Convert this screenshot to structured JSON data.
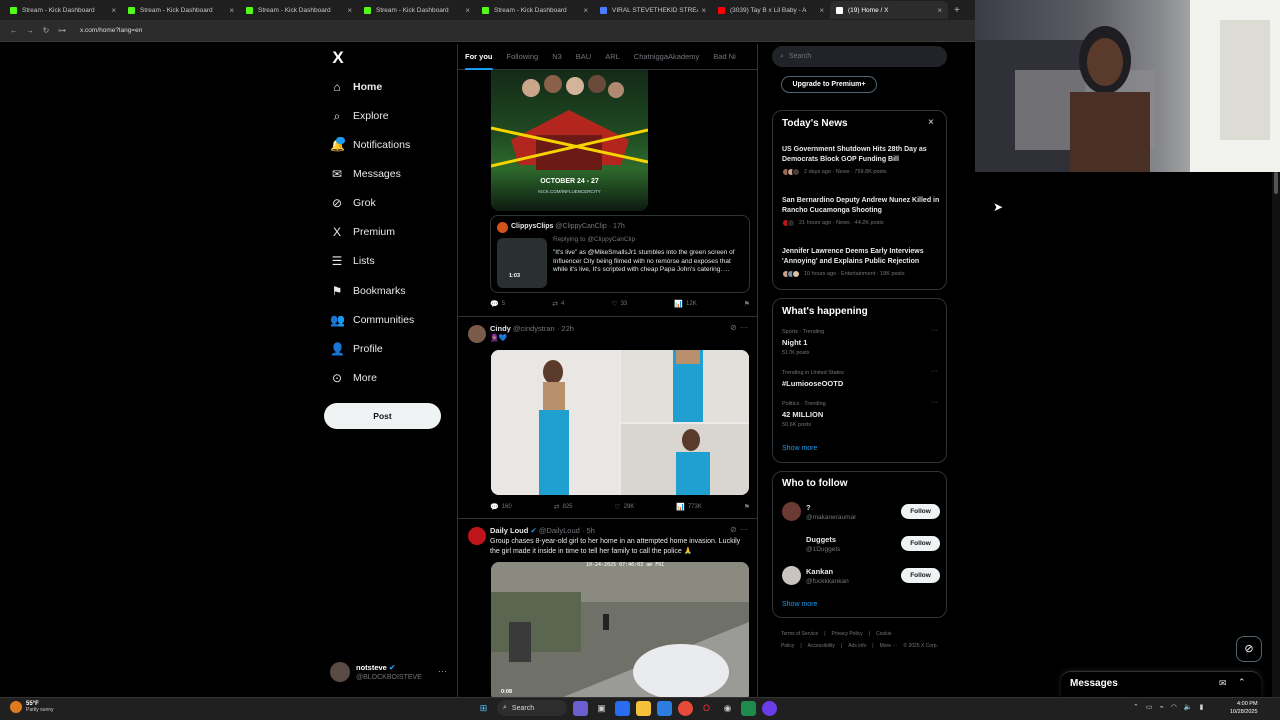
{
  "browser": {
    "tabs": [
      {
        "label": "Stream - Kick Dashboard",
        "color": "#53fc18"
      },
      {
        "label": "Stream - Kick Dashboard",
        "color": "#53fc18"
      },
      {
        "label": "Stream - Kick Dashboard",
        "color": "#53fc18"
      },
      {
        "label": "Stream - Kick Dashboard",
        "color": "#53fc18"
      },
      {
        "label": "Stream - Kick Dashboard",
        "color": "#53fc18"
      },
      {
        "label": "VIRAL STEVETHEKID STREAM",
        "color": "#4a7cff"
      },
      {
        "label": "(3039) Tay B x Lil Baby - A",
        "color": "#ff0000"
      },
      {
        "label": "(19) Home / X",
        "color": "#ffffff"
      }
    ],
    "url": "x.com/home?lang=en"
  },
  "nav": {
    "logo": "X",
    "items": [
      {
        "label": "Home",
        "icon": "home-icon",
        "glyph": "⌂"
      },
      {
        "label": "Explore",
        "icon": "search-icon",
        "glyph": "⌕"
      },
      {
        "label": "Notifications",
        "icon": "bell-icon",
        "glyph": "🔔"
      },
      {
        "label": "Messages",
        "icon": "mail-icon",
        "glyph": "✉"
      },
      {
        "label": "Grok",
        "icon": "grok-icon",
        "glyph": "⊘"
      },
      {
        "label": "Premium",
        "icon": "x-icon",
        "glyph": "X"
      },
      {
        "label": "Lists",
        "icon": "list-icon",
        "glyph": "☰"
      },
      {
        "label": "Bookmarks",
        "icon": "bookmark-icon",
        "glyph": "⚑"
      },
      {
        "label": "Communities",
        "icon": "people-icon",
        "glyph": "👥"
      },
      {
        "label": "Profile",
        "icon": "person-icon",
        "glyph": "👤"
      },
      {
        "label": "More",
        "icon": "more-circle-icon",
        "glyph": "⊙"
      }
    ],
    "notifications_badge": "",
    "post_button": "Post",
    "account": {
      "name": "notsteve",
      "handle": "@BLOCKBOISTEVE"
    }
  },
  "timeline": {
    "tabs": [
      "For you",
      "Following",
      "N3",
      "BAU",
      "ARL",
      "ChatniggaAkademy",
      "Bad Ni"
    ],
    "quote": {
      "name": "ClippysClips",
      "handle": "@ClippyCanClip",
      "time": "· 17h",
      "replying": "Replying to @ClippyCanClip",
      "duration": "1:03",
      "text": "\"It's live\" as @MikeSmallsJr1 stumbles into the green screen of Influencer City being filmed with no remorse and exposes that while it's live, It's scripted with cheap Papa John's catering. ..."
    },
    "poster": {
      "date": "OCTOBER 24 - 27"
    },
    "post1_actions": {
      "replies": "5",
      "reposts": "4",
      "likes": "33",
      "views": "12K"
    },
    "post2": {
      "name": "Cindy",
      "handle": "@cindystran",
      "time": "· 22h",
      "text": "🧕🏽💙",
      "actions": {
        "replies": "160",
        "reposts": "825",
        "likes": "29K",
        "views": "773K"
      }
    },
    "post3": {
      "name": "Daily Loud",
      "handle": "@DailyLoud",
      "time": "· 5h",
      "text": "Group chases 8-year-old girl to her home in an attempted home invasion. Luckily the girl made it inside in time to tell her family to call the police 🙏",
      "cam_stamp": "10-24-2025 07:46:03 am FRI",
      "duration": "0:08"
    }
  },
  "sidebar": {
    "search_placeholder": "Search",
    "upgrade": "Upgrade to Premium+",
    "news": {
      "title": "Today's News",
      "items": [
        {
          "headline": "US Government Shutdown Hits 28th Day as Democrats Block GOP Funding Bill",
          "meta": "2 days ago · News · 759.8K posts"
        },
        {
          "headline": "San Bernardino Deputy Andrew Nunez Killed in Rancho Cucamonga Shooting",
          "meta": "21 hours ago · News · 44.2K posts"
        },
        {
          "headline": "Jennifer Lawrence Deems Early Interviews 'Annoying' and Explains Public Rejection",
          "meta": "10 hours ago · Entertainment · 18K posts"
        }
      ]
    },
    "happening": {
      "title": "What's happening",
      "trends": [
        {
          "category": "Sports · Trending",
          "name": "Night 1",
          "count": "517K posts"
        },
        {
          "category": "Trending in United States",
          "name": "#LumiooseOOTD",
          "count": ""
        },
        {
          "category": "Politics · Trending",
          "name": "42 MILLION",
          "count": "50.6K posts"
        }
      ],
      "show_more": "Show more"
    },
    "who_to_follow": {
      "title": "Who to follow",
      "users": [
        {
          "name": "?",
          "handle": "@makaneraumar",
          "button": "Follow",
          "color": "#6b3a32"
        },
        {
          "name": "Duggets",
          "handle": "@1Duggets",
          "button": "Follow",
          "color": "#000000"
        },
        {
          "name": "Kankan",
          "handle": "@fuckkkankan",
          "button": "Follow",
          "color": "#c9c4bd"
        }
      ],
      "show_more": "Show more"
    },
    "footer": [
      "Terms of Service",
      "|",
      "Privacy Policy",
      "|",
      "Cookie Policy",
      "|",
      "Accessibility",
      "|",
      "Ads info",
      "|",
      "More ···",
      "© 2025 X Corp."
    ]
  },
  "messages_drawer": {
    "title": "Messages"
  },
  "taskbar": {
    "weather_temp": "55°F",
    "weather_desc": "Partly sunny",
    "search": "Search",
    "time": "4:00 PM",
    "date": "10/28/2025"
  }
}
